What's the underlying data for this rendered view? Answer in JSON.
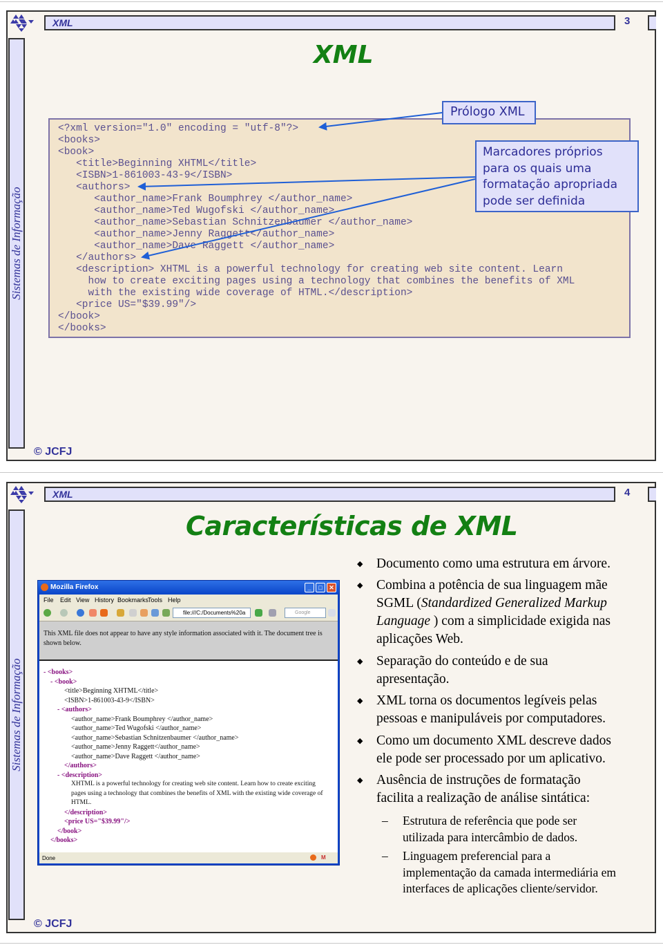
{
  "slides": [
    {
      "header": "XML",
      "page_number": "3",
      "sidebar_text": "Sistemas de Informação",
      "title": "XML",
      "footer": "© JCFJ",
      "code_lines": [
        "<?xml version=\"1.0\" encoding = \"utf-8\"?>",
        "<books>",
        "<book>",
        "   <title>Beginning XHTML</title>",
        "   <ISBN>1-861003-43-9</ISBN>",
        "   <authors>",
        "      <author_name>Frank Boumphrey </author_name>",
        "      <author_name>Ted Wugofski </author_name>",
        "      <author_name>Sebastian Schnitzenbaumer </author_name>",
        "      <author_name>Jenny Raggett</author_name>",
        "      <author_name>Dave Raggett </author_name>",
        "   </authors>",
        "   <description> XHTML is a powerful technology for creating web site content. Learn",
        "     how to create exciting pages using a technology that combines the benefits of XML",
        "     with the existing wide coverage of HTML.</description>",
        "   <price US=\"$39.99\"/>",
        "</book>",
        "</books>"
      ],
      "callouts": {
        "prolog": "Prólogo XML",
        "markers": [
          "Marcadores próprios",
          "para os quais uma",
          "formatação apropriada",
          "pode ser definida"
        ]
      }
    },
    {
      "header": "XML",
      "page_number": "4",
      "sidebar_text": "Sistemas de Informação",
      "title": "Características de XML",
      "footer": "© JCFJ",
      "browser": {
        "window_title": "Mozilla Firefox",
        "menu": [
          "File",
          "Edit",
          "View",
          "History",
          "Bookmarks",
          "Tools",
          "Help"
        ],
        "url": "file:///C:/Documents%20a",
        "search_placeholder": "Google",
        "info": "This XML file does not appear to have any style information associated with it. The document tree is shown below.",
        "status": "Done",
        "tree": {
          "books_open": "- <books>",
          "book_open": "- <book>",
          "title": "<title>Beginning XHTML</title>",
          "isbn": "<ISBN>1-861003-43-9</ISBN>",
          "authors_open": "- <authors>",
          "authors": [
            "<author_name>Frank Boumphrey </author_name>",
            "<author_name>Ted Wugofski </author_name>",
            "<author_name>Sebastian Schnitzenbaumer </author_name>",
            "<author_name>Jenny Raggett</author_name>",
            "<author_name>Dave Raggett </author_name>"
          ],
          "authors_close": "</authors>",
          "description_open": "- <description>",
          "description_lines": [
            "XHTML is a powerful technology for creating web site content. Learn how to create exciting",
            "pages using a technology that combines the benefits of XML with the existing wide coverage of",
            "HTML."
          ],
          "description_close": "</description>",
          "price": "<price US=\"$39.99\"/>",
          "book_close": "</book>",
          "books_close": "</books>"
        }
      },
      "bullets": [
        {
          "lines": [
            "Documento como uma estrutura em árvore."
          ]
        },
        {
          "lines": [
            "Combina a potência de sua linguagem mãe",
            "SGML (Standardized Generalized Markup",
            "Language ) com a simplicidade exigida nas",
            "aplicações Web."
          ]
        },
        {
          "lines": [
            "Separação do conteúdo e de sua",
            "apresentação."
          ]
        },
        {
          "lines": [
            "XML torna os documentos legíveis pelas",
            "pessoas e manipuláveis por computadores."
          ]
        },
        {
          "lines": [
            "Como um documento XML descreve dados",
            "ele pode ser processado por um aplicativo."
          ]
        },
        {
          "lines": [
            "Ausência de instruções de formatação",
            "facilita a realização de análise sintática:"
          ]
        }
      ],
      "sub_bullets": [
        {
          "lines": [
            "Estrutura de referência que pode ser",
            "utilizada para intercâmbio de dados."
          ]
        },
        {
          "lines": [
            "Linguagem preferencial para a",
            "implementação da camada intermediária em",
            "interfaces de aplicações cliente/servidor."
          ]
        }
      ],
      "colors": {
        "accent": "#33339a",
        "title": "#138013",
        "panel": "#e1e1fa"
      }
    }
  ]
}
